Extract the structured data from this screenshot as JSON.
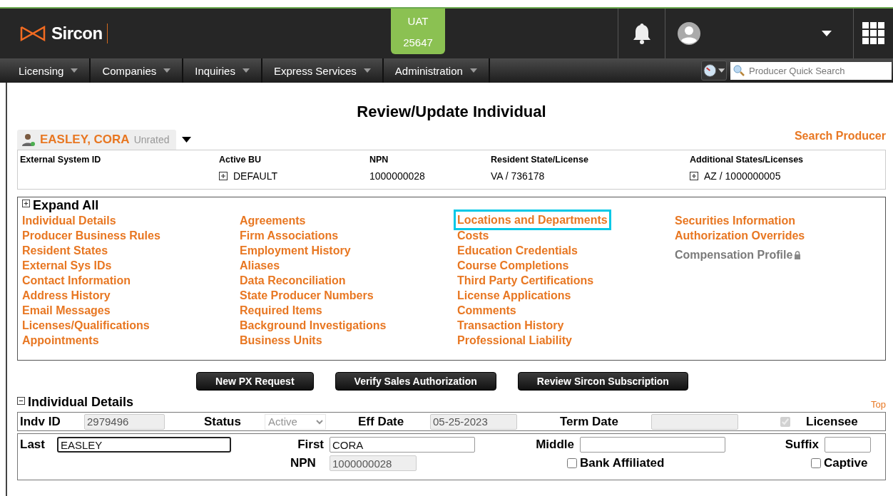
{
  "header": {
    "logo": "Sircon",
    "environment": [
      "UAT",
      "25647"
    ],
    "search": {
      "placeholder": "Producer Quick Search"
    }
  },
  "menu": [
    {
      "label": "Licensing"
    },
    {
      "label": "Companies"
    },
    {
      "label": "Inquiries"
    },
    {
      "label": "Express Services"
    },
    {
      "label": "Administration"
    }
  ],
  "title": "Review/Update Individual",
  "producer": {
    "name": "EASLEY, CORA",
    "rating": "Unrated"
  },
  "search_producer": "Search Producer",
  "summary": [
    {
      "heading": "External System ID"
    },
    {
      "heading": "Active BU",
      "value": "DEFAULT",
      "expandable": true
    },
    {
      "heading": "NPN",
      "value": "1000000028",
      "expandable": false
    },
    {
      "heading": "Resident State/License",
      "value": "VA / 736178",
      "expandable": false
    },
    {
      "heading": "Additional States/Licenses",
      "value": "AZ / 1000000005",
      "expandable": true
    }
  ],
  "expand_all": "Expand All",
  "link_columns": [
    [
      {
        "label": "Individual Details",
        "locked": false,
        "highlighted": false
      },
      {
        "label": "Producer Business Rules",
        "locked": false,
        "highlighted": false
      },
      {
        "label": "Resident States",
        "locked": false,
        "highlighted": false
      },
      {
        "label": "External Sys IDs",
        "locked": false,
        "highlighted": false
      },
      {
        "label": "Contact Information",
        "locked": false,
        "highlighted": false
      },
      {
        "label": "Address History",
        "locked": false,
        "highlighted": false
      },
      {
        "label": "Email Messages",
        "locked": false,
        "highlighted": false
      },
      {
        "label": "Licenses/Qualifications",
        "locked": false,
        "highlighted": false
      },
      {
        "label": "Appointments",
        "locked": false,
        "highlighted": false
      }
    ],
    [
      {
        "label": "Agreements",
        "locked": false,
        "highlighted": false
      },
      {
        "label": "Firm Associations",
        "locked": false,
        "highlighted": false
      },
      {
        "label": "Employment History",
        "locked": false,
        "highlighted": false
      },
      {
        "label": "Aliases",
        "locked": false,
        "highlighted": false
      },
      {
        "label": "Data Reconciliation",
        "locked": false,
        "highlighted": false
      },
      {
        "label": "State Producer Numbers",
        "locked": false,
        "highlighted": false
      },
      {
        "label": "Required Items",
        "locked": false,
        "highlighted": false
      },
      {
        "label": "Background Investigations",
        "locked": false,
        "highlighted": false
      },
      {
        "label": "Business Units",
        "locked": false,
        "highlighted": false
      }
    ],
    [
      {
        "label": "Locations and Departments",
        "locked": false,
        "highlighted": true
      },
      {
        "label": "Costs",
        "locked": false,
        "highlighted": false
      },
      {
        "label": "Education Credentials",
        "locked": false,
        "highlighted": false
      },
      {
        "label": "Course Completions",
        "locked": false,
        "highlighted": false
      },
      {
        "label": "Third Party Certifications",
        "locked": false,
        "highlighted": false
      },
      {
        "label": "License Applications",
        "locked": false,
        "highlighted": false
      },
      {
        "label": "Comments",
        "locked": false,
        "highlighted": false
      },
      {
        "label": "Transaction History",
        "locked": false,
        "highlighted": false
      },
      {
        "label": "Professional Liability",
        "locked": false,
        "highlighted": false
      }
    ],
    [
      {
        "label": "Securities Information",
        "locked": false,
        "highlighted": false
      },
      {
        "label": "Authorization Overrides",
        "locked": false,
        "highlighted": false
      },
      {
        "label": "Compensation Profile",
        "locked": true,
        "highlighted": false
      }
    ]
  ],
  "buttons": [
    "New PX Request",
    "Verify Sales Authorization",
    "Review Sircon Subscription"
  ],
  "section": {
    "title": "Individual Details",
    "top_link": "Top"
  },
  "form_rows": [
    [
      {
        "kind": "text",
        "label": "Indv ID",
        "value": "2979496",
        "disabled": true
      },
      {
        "kind": "select",
        "label": "Status",
        "value": "Active",
        "disabled": true
      },
      {
        "kind": "text",
        "label": "Eff Date",
        "value": "05-25-2023",
        "disabled": true
      },
      {
        "kind": "text",
        "label": "Term Date",
        "disabled": true
      },
      {
        "kind": "checkbox",
        "label": "Licensee",
        "checked": true,
        "disabled": true
      }
    ],
    [
      {
        "kind": "text",
        "label": "Last",
        "value": "EASLEY",
        "disabled": false,
        "focused": true
      },
      {
        "kind": "text",
        "label": "First",
        "value": "CORA",
        "disabled": false,
        "focused": false
      },
      {
        "kind": "text",
        "label": "Middle",
        "disabled": false,
        "focused": false
      },
      {
        "kind": "text",
        "label": "Suffix",
        "disabled": false,
        "focused": false
      }
    ],
    [
      {
        "kind": "text",
        "label": "NPN",
        "value": "1000000028",
        "disabled": true
      },
      {
        "kind": "checkbox",
        "label": "Bank Affiliated",
        "checked": false,
        "disabled": false
      },
      {
        "kind": "checkbox",
        "label": "Captive",
        "checked": false,
        "disabled": false
      }
    ]
  ]
}
